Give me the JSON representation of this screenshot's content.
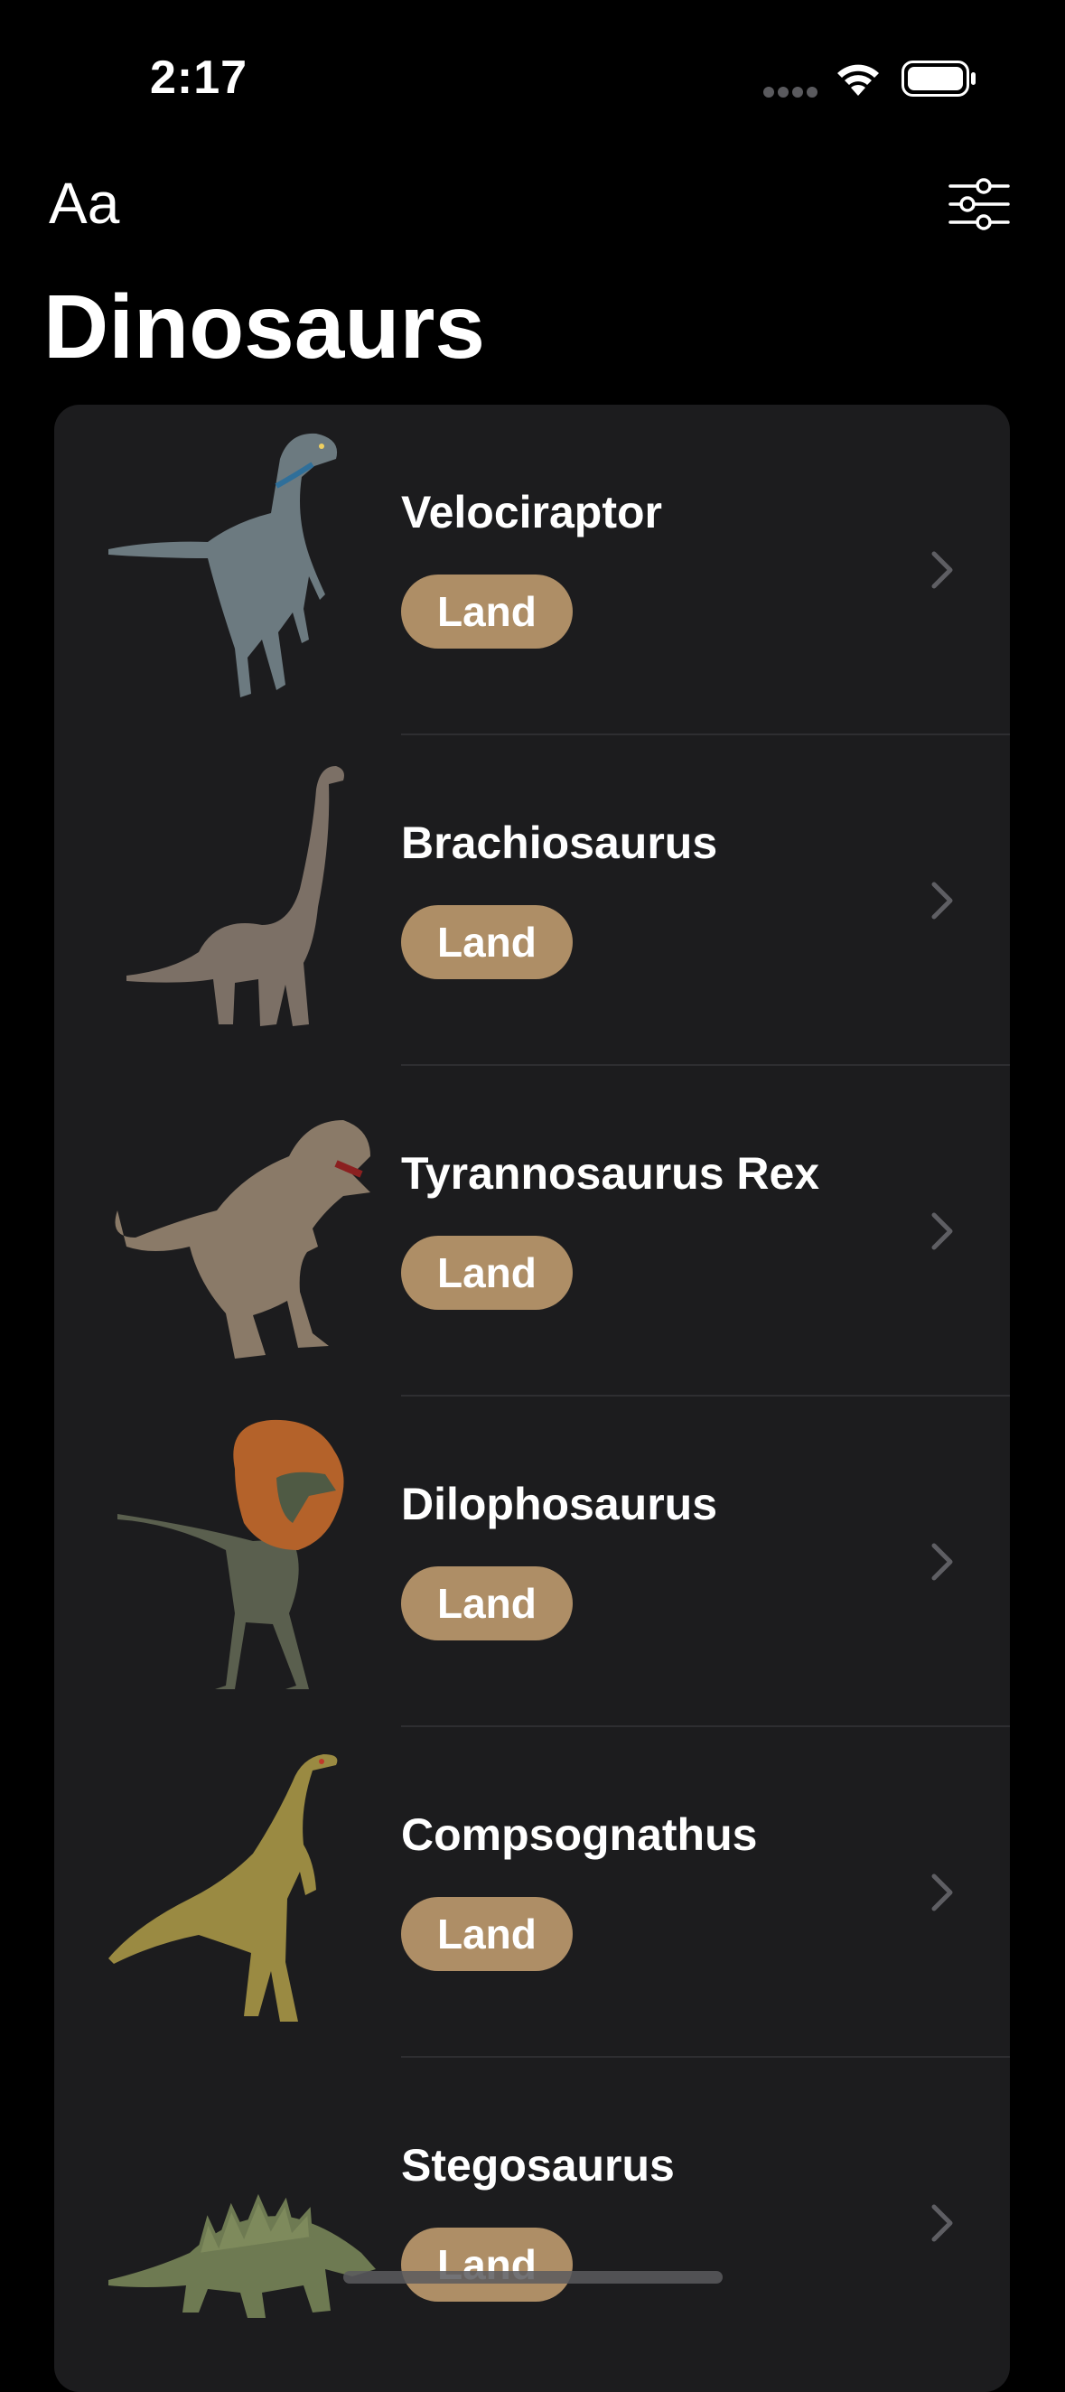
{
  "status_bar": {
    "time": "2:17"
  },
  "nav": {
    "font_button_label": "Aa",
    "filter_icon": "sliders-icon",
    "title": "Dinosaurs"
  },
  "colors": {
    "background": "#000000",
    "card": "#1c1c1e",
    "badge": "#ae8e66",
    "chevron": "#5e5e63",
    "text": "#ffffff"
  },
  "dinosaurs": [
    {
      "name": "Velociraptor",
      "type": "Land",
      "image": "velociraptor-image"
    },
    {
      "name": "Brachiosaurus",
      "type": "Land",
      "image": "brachiosaurus-image"
    },
    {
      "name": "Tyrannosaurus Rex",
      "type": "Land",
      "image": "tyrannosaurus-rex-image"
    },
    {
      "name": "Dilophosaurus",
      "type": "Land",
      "image": "dilophosaurus-image"
    },
    {
      "name": "Compsognathus",
      "type": "Land",
      "image": "compsognathus-image"
    },
    {
      "name": "Stegosaurus",
      "type": "Land",
      "image": "stegosaurus-image"
    }
  ]
}
